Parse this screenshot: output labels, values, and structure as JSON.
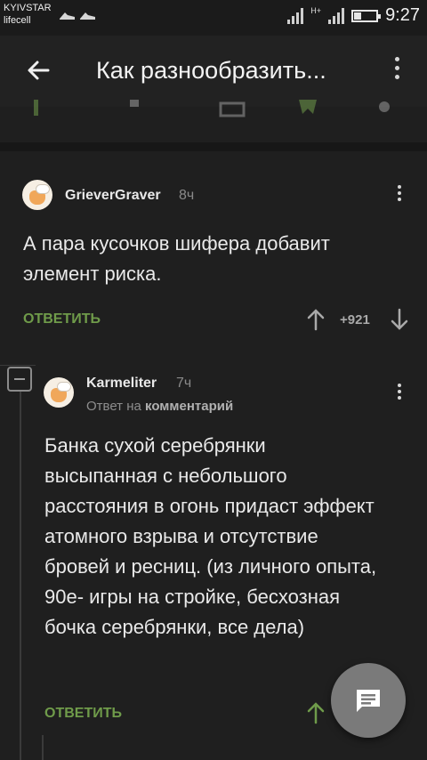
{
  "status_bar": {
    "carrier1": "KYIVSTAR",
    "carrier2": "lifecell",
    "network": "H+",
    "time": "9:27"
  },
  "toolbar": {
    "title": "Как разнообразить..."
  },
  "comments": [
    {
      "username": "GrieverGraver",
      "time": "8ч",
      "text": "А пара кусочков шифера добавит элемент риска.",
      "reply_label": "ОТВЕТИТЬ",
      "rating": "+921"
    },
    {
      "username": "Karmeliter",
      "time": "7ч",
      "reply_to_prefix": "Ответ на",
      "reply_to_target": "комментарий",
      "text": "Банка сухой серебрянки высыпанная с небольшого расстояния в огонь придаст эффект атомного взрыва и отсутствие бровей и ресниц. (из личного опыта, 90е- игры на стройке, бесхозная бочка серебрянки, все дела)",
      "reply_label": "ОТВЕТИТЬ"
    }
  ],
  "colors": {
    "background": "#1f1f1f",
    "accent_green": "#6f9b4a",
    "fab": "#7a7a7a"
  },
  "icons": {
    "back": "arrow-left-icon",
    "menu": "more-vertical-icon",
    "up": "arrow-up-icon",
    "down": "arrow-down-icon",
    "fab": "comment-icon"
  }
}
